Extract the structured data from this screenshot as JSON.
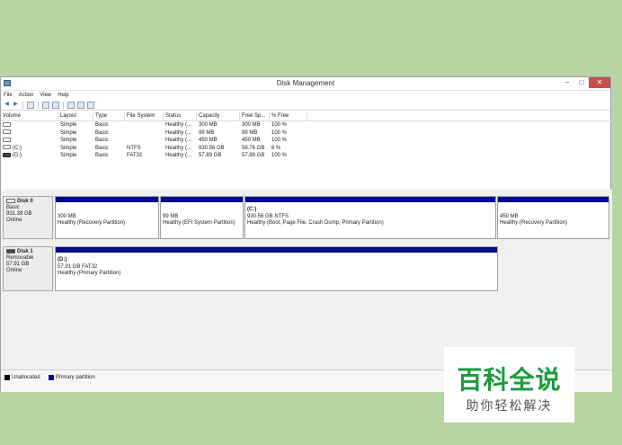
{
  "window": {
    "title": "Disk Management",
    "minimize": "–",
    "maximize": "□",
    "close": "✕"
  },
  "menu": [
    "File",
    "Action",
    "View",
    "Help"
  ],
  "volume_table": {
    "headers": [
      "Volume",
      "Layout",
      "Type",
      "File System",
      "Status",
      "Capacity",
      "Free Sp...",
      "% Free"
    ],
    "rows": [
      [
        "",
        "Simple",
        "Basic",
        "",
        "Healthy (...",
        "300 MB",
        "300 MB",
        "100 %"
      ],
      [
        "",
        "Simple",
        "Basic",
        "",
        "Healthy (...",
        "99 MB",
        "99 MB",
        "100 %"
      ],
      [
        "",
        "Simple",
        "Basic",
        "",
        "Healthy (...",
        "450 MB",
        "450 MB",
        "100 %"
      ],
      [
        "(C:)",
        "Simple",
        "Basic",
        "NTFS",
        "Healthy (...",
        "930.56 GB",
        "58.76 GB",
        "6 %"
      ],
      [
        "(D:)",
        "Simple",
        "Basic",
        "FAT32",
        "Healthy (...",
        "57.89 GB",
        "57.89 GB",
        "100 %"
      ]
    ]
  },
  "disks": [
    {
      "name": "Disk 0",
      "type": "Basic",
      "size": "931.39 GB",
      "status": "Online",
      "partitions": [
        {
          "label": "",
          "size": "300 MB",
          "status": "Healthy (Recovery Partition)"
        },
        {
          "label": "",
          "size": "99 MB",
          "status": "Healthy (EFI System Partition)"
        },
        {
          "label": "(C:)",
          "size": "930.56 GB NTFS",
          "status": "Healthy (Boot, Page File, Crash Dump, Primary Partition)"
        },
        {
          "label": "",
          "size": "450 MB",
          "status": "Healthy (Recovery Partition)"
        }
      ]
    },
    {
      "name": "Disk 1",
      "type": "Removable",
      "size": "57.91 GB",
      "status": "Online",
      "partitions": [
        {
          "label": "(D:)",
          "size": "57.91 GB FAT32",
          "status": "Healthy (Primary Partition)"
        }
      ]
    }
  ],
  "legend": [
    {
      "label": "Unallocated",
      "color": "#000000"
    },
    {
      "label": "Primary partition",
      "color": "#000c8a"
    }
  ],
  "watermark": {
    "title": "百科全说",
    "subtitle": "助你轻松解决",
    "color": "#1c9b3f"
  }
}
